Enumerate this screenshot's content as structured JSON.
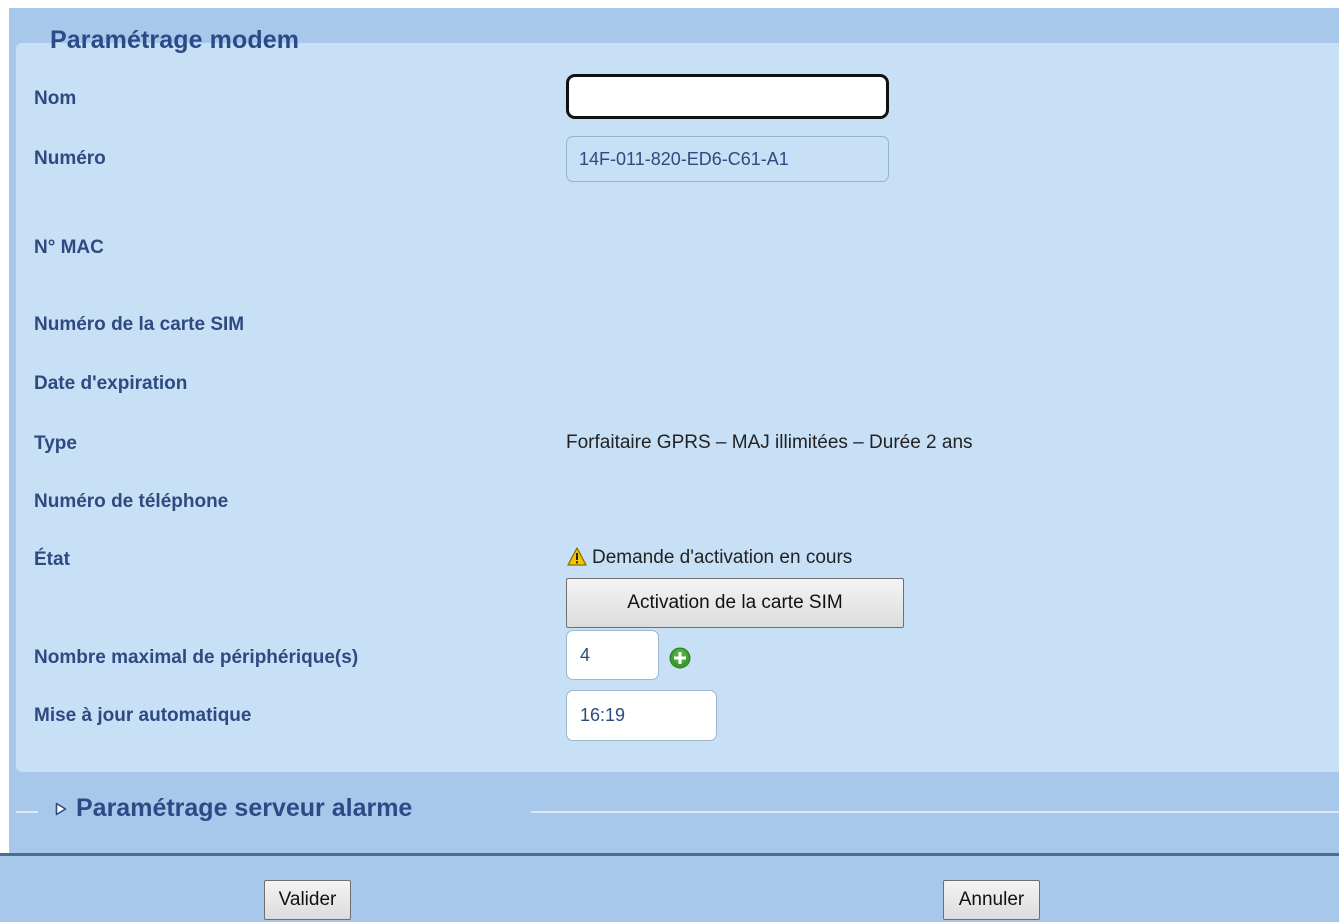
{
  "modem_section": {
    "title": "Paramétrage modem",
    "fields": {
      "nom": {
        "label": "Nom",
        "value": ""
      },
      "numero": {
        "label": "Numéro",
        "value": "14F-011-820-ED6-C61-A1"
      },
      "mac": {
        "label": "N° MAC"
      },
      "sim_number": {
        "label": "Numéro de la carte SIM"
      },
      "expiration": {
        "label": "Date d'expiration"
      },
      "type": {
        "label": "Type",
        "value": "Forfaitaire GPRS – MAJ illimitées – Durée 2 ans"
      },
      "phone": {
        "label": "Numéro de téléphone"
      },
      "etat": {
        "label": "État",
        "value": "Demande d'activation en cours",
        "status_icon": "warning-icon",
        "status_color": "#f2c700"
      },
      "activate_button": {
        "label": "Activation de la carte SIM"
      },
      "max_devices": {
        "label": "Nombre maximal de périphérique(s)",
        "value": "4",
        "add_icon": "plus-icon",
        "add_color": "#3a9c2e"
      },
      "auto_update": {
        "label": "Mise à jour automatique",
        "value": "16:19"
      }
    }
  },
  "alarm_section": {
    "title": "Paramétrage serveur alarme",
    "expander_icon": "triangle-right-icon"
  },
  "footer": {
    "validate_label": "Valider",
    "cancel_label": "Annuler"
  },
  "colors": {
    "background": "#a7c8ea",
    "panel": "#c8e0f5",
    "label": "#2e4a80",
    "title": "#2c4a86"
  }
}
